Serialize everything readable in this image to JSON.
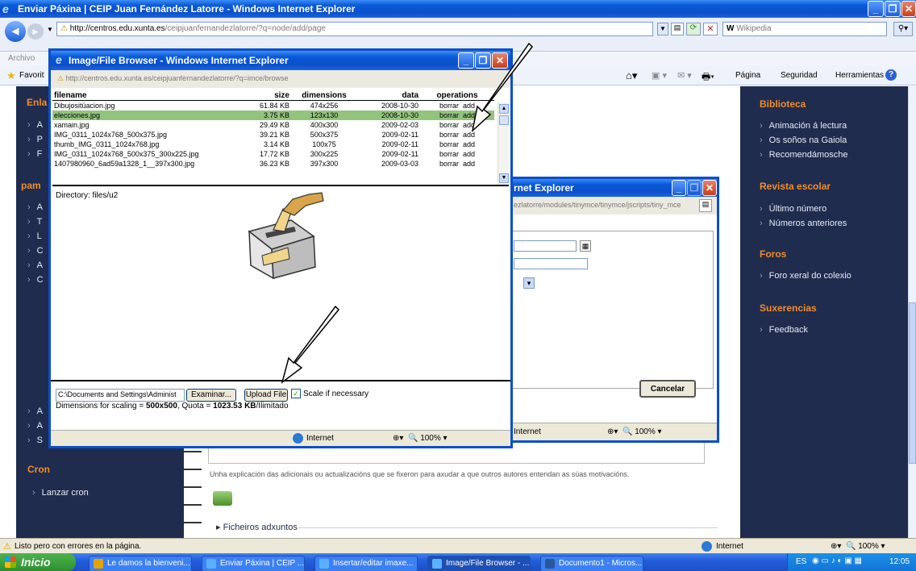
{
  "browser": {
    "title": "Enviar Páxina | CEIP Juan Fernández Latorre - Windows Internet Explorer",
    "url_host": "http://centros.edu.xunta.es",
    "url_path": "/ceipjuanfernandezlatorre/?q=node/add/page",
    "search_placeholder": "Wikipedia",
    "menu_first": "Archivo",
    "favorites": "Favorit",
    "cmd_items": [
      "Página",
      "Seguridad",
      "Herramientas"
    ],
    "status_text": "Listo pero con errores en la página.",
    "status_zone": "Internet",
    "zoom": "100%"
  },
  "left_sidebar": {
    "block1_title": "Enla",
    "block2_title": "pam",
    "cron_title": "Cron",
    "cron_item": "Lanzar cron",
    "letters1": [
      "A",
      "P",
      "F"
    ],
    "letters2": [
      "A",
      "T",
      "L",
      "C",
      "A",
      "C"
    ],
    "letters3": [
      "A",
      "A",
      "S"
    ]
  },
  "main": {
    "help_text": "Unha explicación das adicionais ou actualizacións que se fixeron para axudar a que outros autores entendan as súas motivacións.",
    "attachments": "Ficheiros adxuntos"
  },
  "right_sidebar": {
    "sections": [
      {
        "title": "Biblioteca",
        "items": [
          "Animación á lectura",
          "Os soños na Gaiola",
          "Recomendámosche"
        ]
      },
      {
        "title": "Revista escolar",
        "items": [
          "Último número",
          "Números anteriores"
        ]
      },
      {
        "title": "Foros",
        "items": [
          "Foro xeral do colexio"
        ]
      },
      {
        "title": "Suxerencias",
        "items": [
          "Feedback"
        ]
      }
    ]
  },
  "insert_dialog": {
    "title_fragment": "rnet Explorer",
    "url_fragment": "ezlatorre/modules/tinymce/tinymce/jscripts/tiny_mce",
    "cancel_label": "Cancelar",
    "status_zone": "Internet",
    "zoom": "100%"
  },
  "file_browser": {
    "title": "Image/File Browser - Windows Internet Explorer",
    "url_host": "http://centros.edu.xunta.es",
    "url_path": "/ceipjuanfernandezlatorre/?q=imce/browse",
    "columns": [
      "filename",
      "size",
      "dimensions",
      "data",
      "operations"
    ],
    "rows": [
      {
        "filename": "Dibujositüacion.jpg",
        "size": "61.84 KB",
        "dims": "474x256",
        "date": "2008-10-30",
        "ops": "borrar  add"
      },
      {
        "filename": "elecciones.jpg",
        "size": "3.75 KB",
        "dims": "123x130",
        "date": "2008-10-30",
        "ops": "borrar  add"
      },
      {
        "filename": "xamain.jpg",
        "size": "29.49 KB",
        "dims": "400x300",
        "date": "2009-02-03",
        "ops": "borrar  add"
      },
      {
        "filename": "IMG_0311_1024x768_500x375.jpg",
        "size": "39.21 KB",
        "dims": "500x375",
        "date": "2009-02-11",
        "ops": "borrar  add"
      },
      {
        "filename": "thumb_IMG_0311_1024x768.jpg",
        "size": "3.14 KB",
        "dims": "100x75",
        "date": "2009-02-11",
        "ops": "borrar  add"
      },
      {
        "filename": "IMG_0311_1024x768_500x375_300x225.jpg",
        "size": "17.72 KB",
        "dims": "300x225",
        "date": "2009-02-11",
        "ops": "borrar  add"
      },
      {
        "filename": "1407980960_6ad59a1328_1__397x300.jpg",
        "size": "36.23 KB",
        "dims": "397x300",
        "date": "2009-03-03",
        "ops": "borrar  add"
      }
    ],
    "directory": "Directory: files/u2",
    "file_path": "C:\\Documents and Settings\\Administ",
    "browse_label": "Examinar...",
    "upload_label": "Upload File",
    "scale_label": "Scale if necessary",
    "dims_prefix": "Dimensions for scaling = ",
    "dims_value": "500x500",
    "quota_prefix": ", Quota = ",
    "quota_value": "1023.53 KB",
    "quota_suffix": "/Ilimitado",
    "status_zone": "Internet",
    "zoom": "100%"
  },
  "taskbar": {
    "start_label": "Inicio",
    "buttons": [
      "Le damos la bienveni...",
      "Enviar Páxina | CEIP ...",
      "Insertar/editar imaxe...",
      "Image/File Browser - ...",
      "Documento1 - Micros..."
    ],
    "lang": "ES",
    "clock": "12:05"
  },
  "colors": {
    "accent_orange": "#f28c28",
    "sidebar_bg": "#1f2c4e",
    "xp_blue": "#0b4fc9",
    "selected_row": "#93c47d"
  }
}
